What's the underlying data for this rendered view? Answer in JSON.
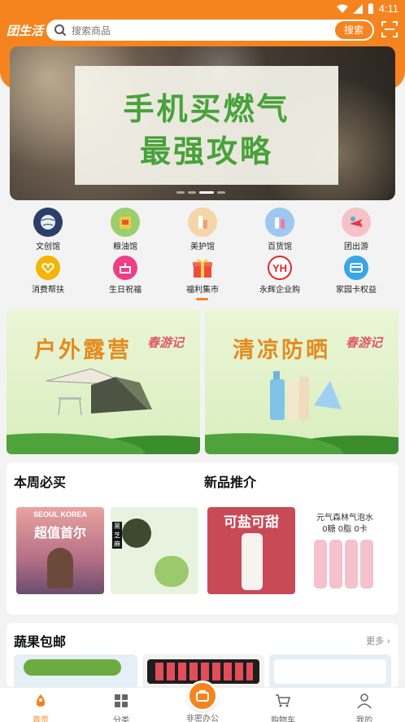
{
  "status_bar": {
    "time": "4:11"
  },
  "header": {
    "logo": "团生活",
    "search_placeholder": "搜索商品",
    "search_button": "搜索"
  },
  "banner": {
    "line1": "手机买燃气",
    "line2": "最强攻略"
  },
  "categories_row1": [
    {
      "label": "文创馆",
      "icon": "globe-icon",
      "color": "#2c3e6b"
    },
    {
      "label": "粮油馆",
      "icon": "grocery-icon",
      "color": "#9bcf6a"
    },
    {
      "label": "美护馆",
      "icon": "cosmetics-icon",
      "color": "#f4d6a8"
    },
    {
      "label": "百货馆",
      "icon": "bottles-icon",
      "color": "#9fc8f0"
    },
    {
      "label": "团出游",
      "icon": "travel-icon",
      "color": "#f7c1c8"
    }
  ],
  "categories_row2": [
    {
      "label": "消费帮扶",
      "icon": "heart-hands-icon",
      "color": "#f5b400"
    },
    {
      "label": "生日祝福",
      "icon": "cake-icon",
      "color": "#ee3e86"
    },
    {
      "label": "福利集市",
      "icon": "gift-icon",
      "color": "#ef4b3f"
    },
    {
      "label": "永辉企业购",
      "icon": "yh-logo-icon",
      "color": "#e32626",
      "badge": "YH"
    },
    {
      "label": "家园卡权益",
      "icon": "card-icon",
      "color": "#39a6e6"
    }
  ],
  "promos": [
    {
      "title": "户外露营",
      "brand": "春游记"
    },
    {
      "title": "清凉防晒",
      "brand": "春游记"
    }
  ],
  "weekly": {
    "left_title": "本周必买",
    "right_title": "新品推介",
    "products": [
      {
        "name": "seoul-korea-product",
        "lines": [
          "SEOUL KOREA",
          "超值首尔"
        ]
      },
      {
        "name": "mochi-product",
        "lines": [
          "黑芝麻"
        ]
      },
      {
        "name": "lychee-drink-product",
        "lines": [
          "可盐可甜"
        ]
      },
      {
        "name": "sparkling-water-product",
        "lines": [
          "元气森林气泡水",
          "0糖 0脂 0卡"
        ]
      }
    ]
  },
  "fruit": {
    "title": "蔬果包邮",
    "more": "更多"
  },
  "tabbar": {
    "items": [
      {
        "label": "首页",
        "icon": "home-icon"
      },
      {
        "label": "分类",
        "icon": "category-icon"
      },
      {
        "label": "非密办公",
        "icon": "briefcase-icon"
      },
      {
        "label": "购物车",
        "icon": "cart-icon"
      },
      {
        "label": "我的",
        "icon": "profile-icon"
      }
    ]
  }
}
